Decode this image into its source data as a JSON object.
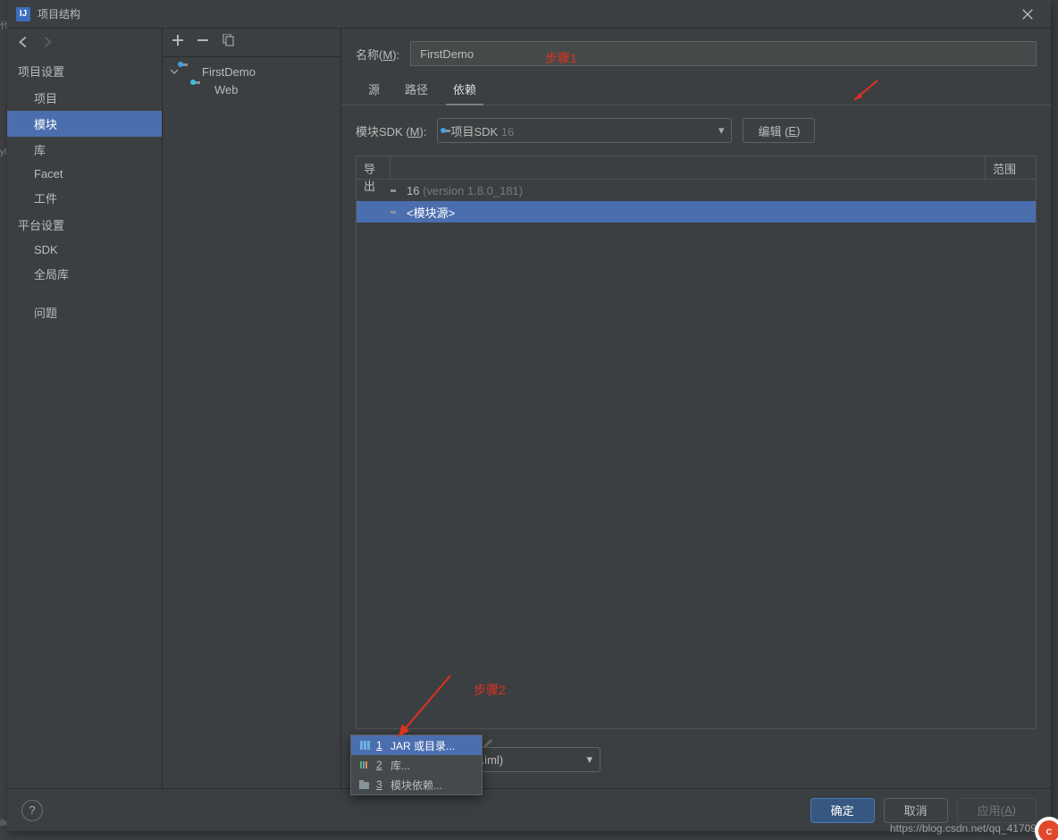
{
  "window": {
    "title": "项目结构",
    "logo_letter": "IJ"
  },
  "left_edge": {
    "l1": "代",
    "l2": "yl",
    "l3": "ile"
  },
  "sidebar": {
    "section_project": "项目设置",
    "items_project": [
      {
        "label": "项目"
      },
      {
        "label": "模块",
        "selected": true
      },
      {
        "label": "库"
      },
      {
        "label": "Facet"
      },
      {
        "label": "工件"
      }
    ],
    "section_platform": "平台设置",
    "items_platform": [
      {
        "label": "SDK"
      },
      {
        "label": "全局库"
      }
    ],
    "issues_label": "问题"
  },
  "tree": {
    "root": "FirstDemo",
    "child": "Web"
  },
  "content": {
    "name_label_prefix": "名称(",
    "name_label_mnemonic": "M",
    "name_label_suffix": "):",
    "name_value": "FirstDemo",
    "tabs": [
      {
        "label": "源"
      },
      {
        "label": "路径"
      },
      {
        "label": "依赖",
        "active": true
      }
    ],
    "sdk_label_prefix": "模块SDK (",
    "sdk_label_mnemonic": "M",
    "sdk_label_suffix": "):",
    "sdk_value_prefix": "项目SDK ",
    "sdk_value_ver": "16",
    "edit_btn_prefix": "编辑 (",
    "edit_btn_mnemonic": "E",
    "edit_btn_suffix": ")",
    "col_export": "导出",
    "col_scope": "范围",
    "dep_rows": [
      {
        "name": "16 ",
        "extra": "(version 1.8.0_181)"
      },
      {
        "name": "<模块源>",
        "selected": true
      }
    ],
    "format_value": " IDEA (.iml)"
  },
  "popup": {
    "items": [
      {
        "num": "1",
        "label": "JAR 或目录...",
        "selected": true
      },
      {
        "num": "2",
        "label": "库..."
      },
      {
        "num": "3",
        "label": "模块依赖..."
      }
    ]
  },
  "annotations": {
    "step1": "步骤1",
    "step2": "步骤2"
  },
  "footer": {
    "ok": "确定",
    "cancel": "取消",
    "apply_prefix": "应用(",
    "apply_mnemonic": "A",
    "apply_suffix": ")"
  },
  "watermark": "https://blog.csdn.net/qq_41709493"
}
